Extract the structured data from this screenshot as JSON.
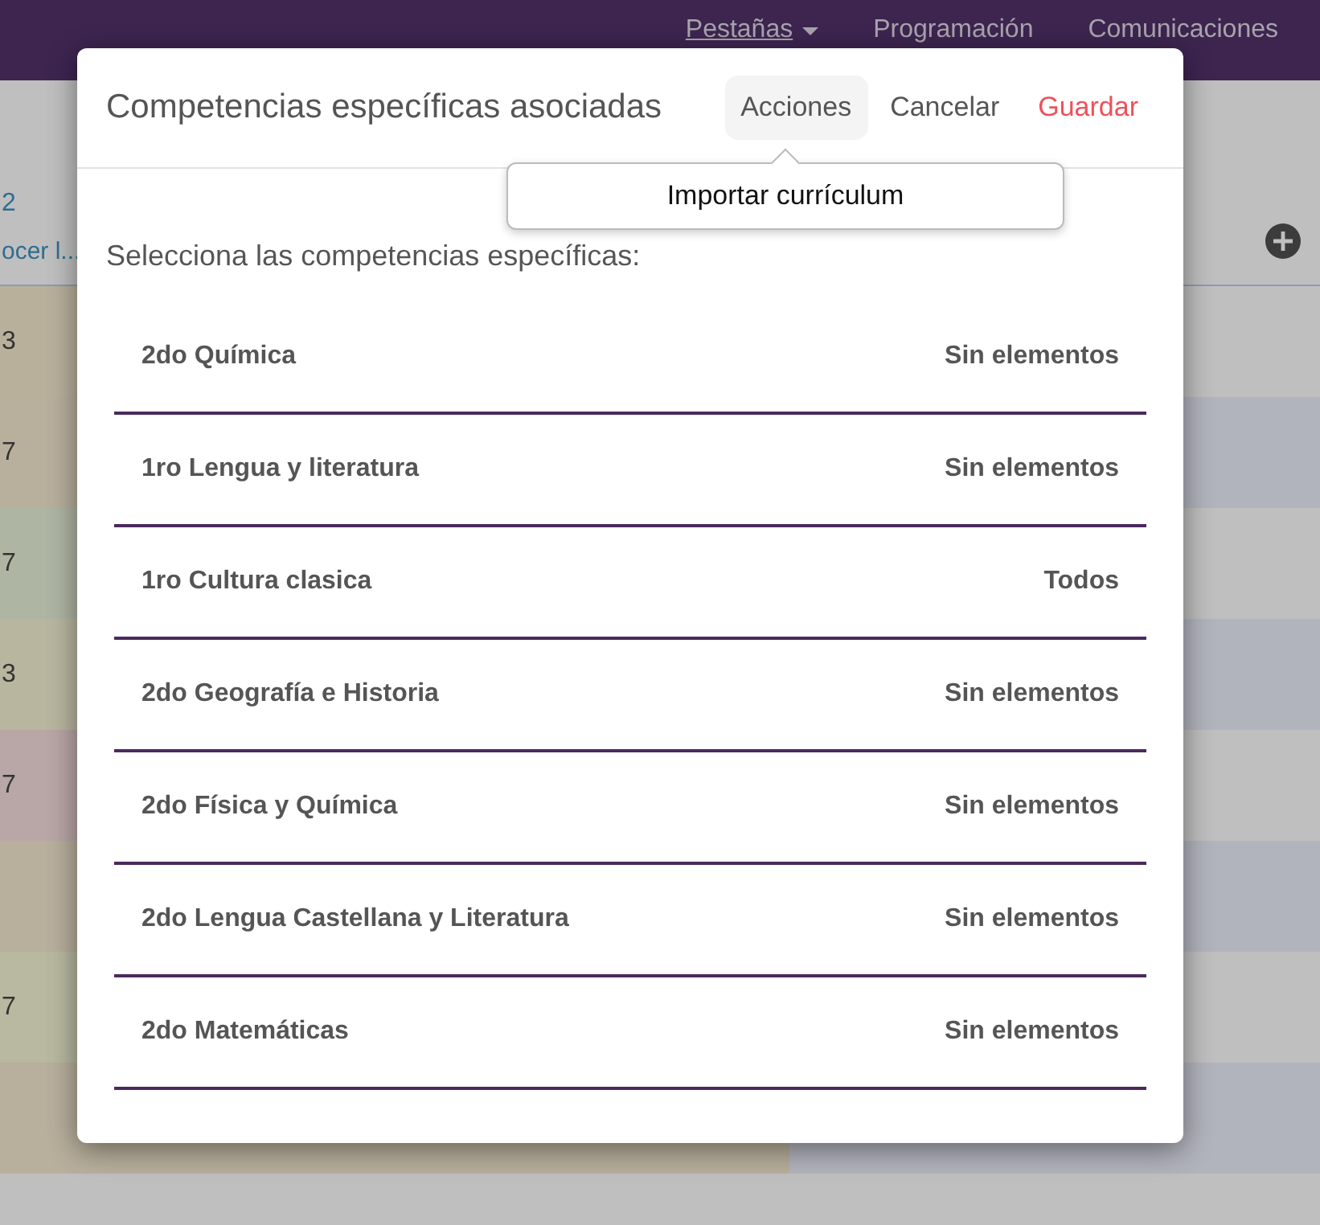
{
  "nav": [
    {
      "label": "Pestañas",
      "dropdown": true
    },
    {
      "label": "Programación",
      "dropdown": false
    },
    {
      "label": "Comunicaciones",
      "dropdown": false
    }
  ],
  "page": {
    "header_number": "2",
    "header_link": "ocer l...",
    "rows": [
      {
        "value": "3",
        "color": "#b9b09c"
      },
      {
        "value": "7",
        "color": "#b8af9c"
      },
      {
        "value": "7",
        "color": "#afb5a3"
      },
      {
        "value": "3",
        "color": "#b9b6a0"
      },
      {
        "value": "7",
        "color": "#b9a6a7"
      },
      {
        "value": "",
        "color": "#b8af9c"
      },
      {
        "value": "7",
        "color": "#b8b9a0"
      },
      {
        "value": "",
        "color": "#b8af9c"
      }
    ]
  },
  "modal": {
    "title": "Competencias específicas asociadas",
    "actions": "Acciones",
    "cancel": "Cancelar",
    "save": "Guardar",
    "menu": [
      {
        "label": "Importar currículum"
      }
    ],
    "prompt": "Selecciona las competencias específicas:",
    "items": [
      {
        "name": "2do Química",
        "status": "Sin elementos"
      },
      {
        "name": "1ro Lengua y literatura",
        "status": "Sin elementos"
      },
      {
        "name": "1ro Cultura clasica",
        "status": "Todos"
      },
      {
        "name": "2do Geografía e Historia",
        "status": "Sin elementos"
      },
      {
        "name": "2do Física y Química",
        "status": "Sin elementos"
      },
      {
        "name": "2do Lengua Castellana y Literatura",
        "status": "Sin elementos"
      },
      {
        "name": "2do Matemáticas",
        "status": "Sin elementos"
      }
    ]
  }
}
